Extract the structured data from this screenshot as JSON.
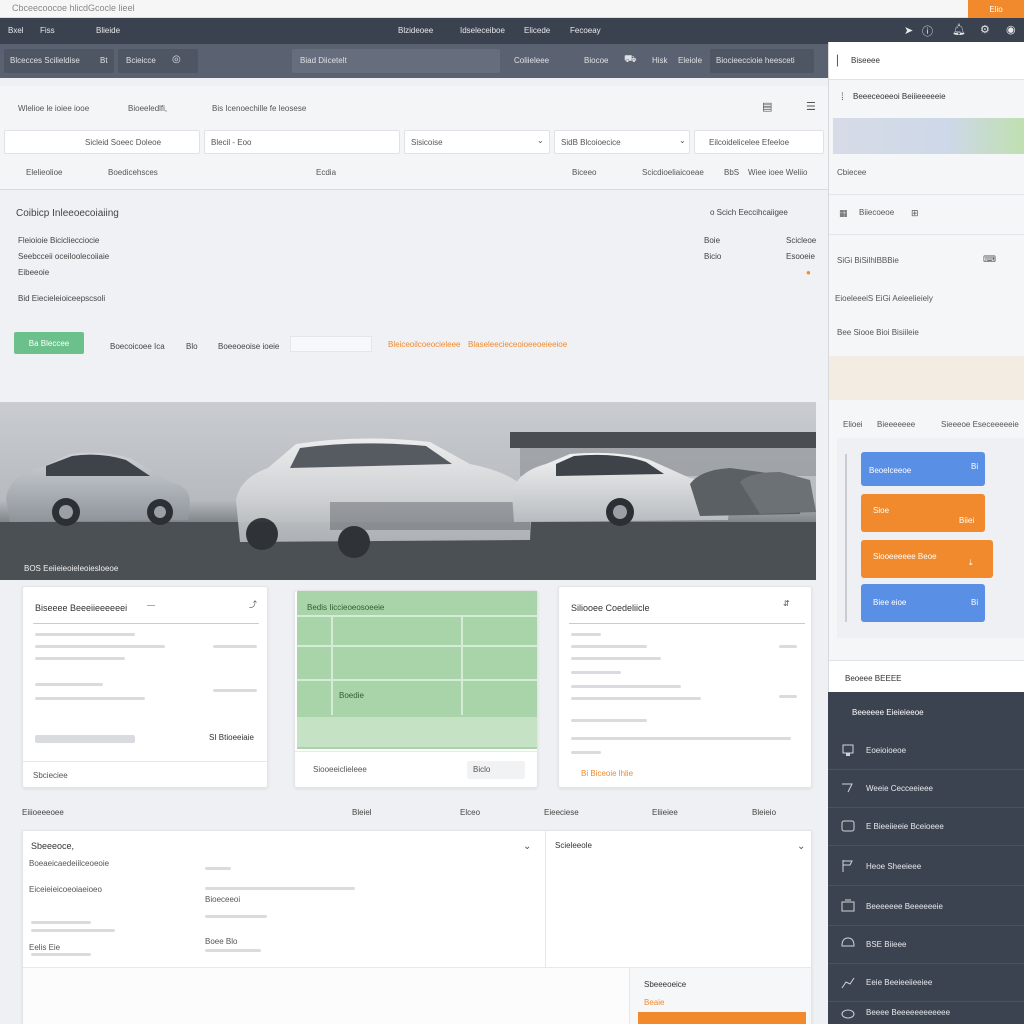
{
  "topstrip": {
    "title": "Cbceecoocoe hlicdGcocle lieel",
    "badge": "Elio"
  },
  "menubar": {
    "items": [
      "Bxel",
      "Fiss",
      "Blieide"
    ],
    "center_items": [
      "Blzideoee",
      "Idseleceiboe",
      "Elicede",
      "Fecoeay"
    ]
  },
  "toolbar": {
    "left": "Blcecces Scilieldise",
    "count": "Bt",
    "menu": "Bcieicce",
    "search_value": "Biad Diicetelt",
    "right_items": [
      "Coliieleee",
      "Biocoe",
      "Hisk",
      "Eleiole",
      "Biocieeccioie heesceti"
    ]
  },
  "header": {
    "row1": [
      "Wlelioe le ioiee iooe",
      "Bioeeledlfi,",
      "Bis Icenoechille fe leosese"
    ],
    "fields": [
      {
        "value": "",
        "placeholder": "Sicleid Soeec Doleoe"
      },
      {
        "value": "Blecil - Eoo",
        "placeholder": ""
      },
      {
        "value": "Sisicoise",
        "placeholder": ""
      },
      {
        "value": "SidB Blcoioecice",
        "placeholder": ""
      },
      {
        "value": "Eilcoidelicelee Efeeloe",
        "placeholder": ""
      }
    ],
    "row3": [
      "Elelieolioe",
      "Boedicehsces",
      "Ecdia",
      "Biceeo",
      "Scicdioeliaicoeae",
      "BbS",
      "Wiee ioee Weliio"
    ]
  },
  "content": {
    "heading": "Coibicp Inleeoecoiaiing",
    "right_heading": "o Scich Eeccihcaiigee",
    "rows": [
      {
        "label": "Fleioioie Bicicliecciocie",
        "mid": "Boie",
        "right": "Scicleoe"
      },
      {
        "label": "Seebcceii oceiloolecoiiaie",
        "mid": "Bicio",
        "right": "Esooeie"
      },
      {
        "label": "Eibeeoie",
        "mid": "",
        "right": ""
      }
    ],
    "subline": "Bid Eiecieleioiceepscsoli",
    "button": "Ba Bleccee",
    "filters": [
      "Boecoicoee Ica",
      "Blo",
      "Boeeoeoise ioeie"
    ],
    "link1": "Bleiceoilcoeocieleee",
    "link2": "Blaseleecieceoioeeoeieeioe"
  },
  "hero": {
    "caption": "BOS Eeiieieoieleoiesloeoe"
  },
  "cards": {
    "card1": {
      "title": "Biseeee Beeeiieeeeeei",
      "footer": "Sbcieciee",
      "value": "SI Btioeeiaie"
    },
    "card2": {
      "title": "Bedis Iiccieoeosoeeie",
      "row": "Boedie",
      "footer": "Siooeeiclieleee",
      "action": "Biclo"
    },
    "card3": {
      "title": "Siliooee Coedeliicle",
      "link": "Bi Biceoie lhlie"
    }
  },
  "lower": {
    "labels": [
      "Eiiioeeeoee",
      "Bleiel",
      "Elceo",
      "Eieeciese",
      "Eliieiee",
      "Bleieio"
    ],
    "left_title": "Sbeeeoce,",
    "lines": [
      "Boeaeicaedeiilceoeoie",
      "Eiceieieicoeoiaeioeo",
      "Eelis Eie",
      "Bioeceeoi",
      "Boee Blo"
    ],
    "right_title": "Scieleeole",
    "box_title": "Sbeeeoeice",
    "box_value": "Beaie"
  },
  "sidebar": {
    "header": "Biseeee",
    "subheader": "Beeeceoeeoi Beiiieeeeeie",
    "section1": "Cbiecee",
    "item1": "Biiecoeoe",
    "item2": "SiGi BiSilhlBBBie",
    "item3": "EioeleeeiS EiGi Aeieelieiely",
    "item4": "Bee Siooe Bioi Bisiileie",
    "tabs": [
      "Elioei",
      "Bieeeeeee",
      "Sieeeoe Eseceeeeeie"
    ],
    "tiles": [
      {
        "label": "Beoelceeoe",
        "sub": "Bi",
        "color": "#5a8fe6"
      },
      {
        "label": "Sioe",
        "sub": "Biiei",
        "color": "#f08a2c"
      },
      {
        "label": "Siooeeeeee Beoe",
        "sub": "",
        "color": "#f08a2c"
      },
      {
        "label": "Biee eioe",
        "sub": "Bi",
        "color": "#5a8fe6"
      }
    ],
    "footer_label": "Beoeee BEEEE"
  },
  "darknav": {
    "title": "Beeeeee Eieieieeoe",
    "items": [
      "Eoeioioeoe",
      "Weeie Cecceeieee",
      "E Bieeiieeie Bceioeee",
      "Heoe Sheeieee",
      "Beeeeeee Beeeeeeie",
      "BSE Biieee",
      "Eeie Beeieeiieeiee",
      "Beeee Beeeeeeeeeeee"
    ]
  }
}
